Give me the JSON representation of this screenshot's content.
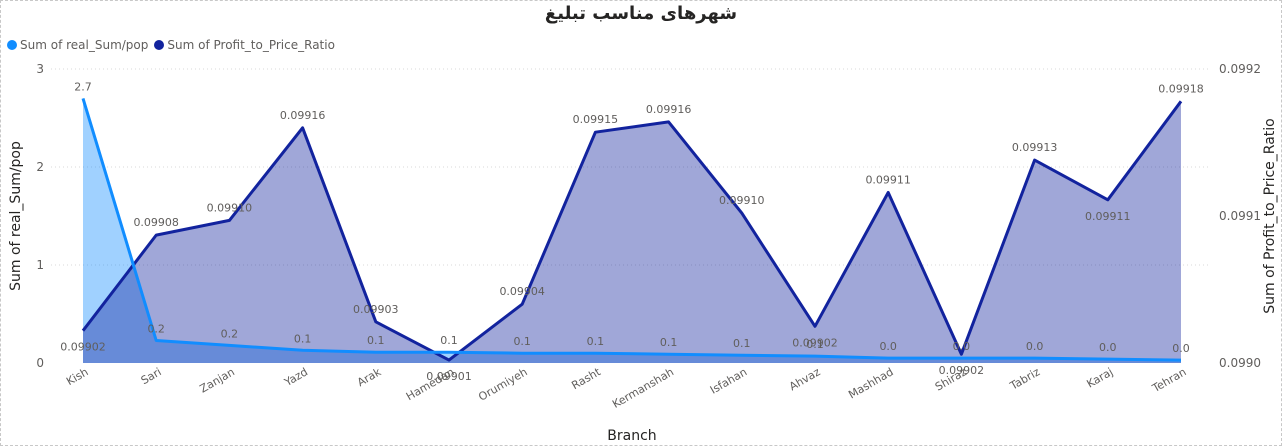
{
  "title": "شهرهای مناسب تبلیغ",
  "legend": {
    "items": [
      {
        "label": "Sum of real_Sum/pop",
        "color": "#118DFF"
      },
      {
        "label": "Sum of Profit_to_Price_Ratio",
        "color": "#12239E"
      }
    ]
  },
  "chart_data": {
    "type": "area",
    "title": "شهرهای مناسب تبلیغ",
    "xlabel": "Branch",
    "ylabel": "Sum of real_Sum/pop",
    "y2label": "Sum of Profit_to_Price_Ratio",
    "categories": [
      "Kish",
      "Sari",
      "Zanjan",
      "Yazd",
      "Arak",
      "Hamedan",
      "Orumiyeh",
      "Rasht",
      "Kermanshah",
      "Isfahan",
      "Ahvaz",
      "Mashhad",
      "Shiraz",
      "Tabriz",
      "Karaj",
      "Tehran"
    ],
    "ylim": [
      0,
      3
    ],
    "yticks": [
      "0",
      "1",
      "2",
      "3"
    ],
    "y2lim": [
      0.099,
      0.0992
    ],
    "y2ticks": [
      "0.0990",
      "0.0991",
      "0.0992"
    ],
    "grid": true,
    "legend_position": "top-left",
    "series": [
      {
        "name": "Sum of real_Sum/pop",
        "axis": "left",
        "color": "#118DFF",
        "values": [
          2.7,
          0.23,
          0.18,
          0.13,
          0.11,
          0.11,
          0.1,
          0.1,
          0.09,
          0.08,
          0.07,
          0.05,
          0.05,
          0.05,
          0.04,
          0.03
        ],
        "labels": [
          "2.7",
          "0.2",
          "0.2",
          "0.1",
          "0.1",
          "0.1",
          "0.1",
          "0.1",
          "0.1",
          "0.1",
          "0.1",
          "0.0",
          "0.0",
          "0.0",
          "0.0",
          "0.0"
        ]
      },
      {
        "name": "Sum of Profit_to_Price_Ratio",
        "axis": "right",
        "color": "#12239E",
        "values": [
          0.099022,
          0.099087,
          0.099097,
          0.09916,
          0.099028,
          0.099002,
          0.09904,
          0.099157,
          0.099164,
          0.099102,
          0.099025,
          0.099116,
          0.099006,
          0.099138,
          0.099111,
          0.099178
        ],
        "labels": [
          "0.09902",
          "0.09908",
          "0.09910",
          "0.09916",
          "0.09903",
          "0.09901",
          "0.09904",
          "0.09915",
          "0.09916",
          "0.09910",
          "0.09902",
          "0.09911",
          "0.09902",
          "0.09913",
          "0.09911",
          "0.09918"
        ]
      }
    ]
  }
}
